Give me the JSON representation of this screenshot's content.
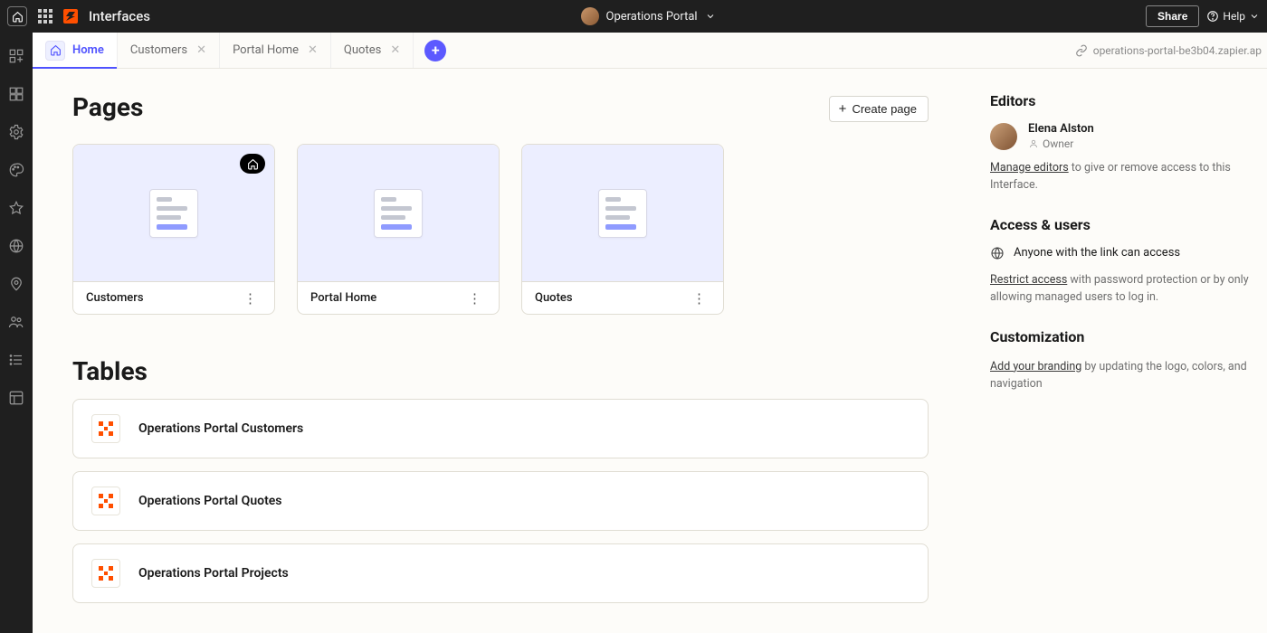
{
  "topbar": {
    "title": "Interfaces",
    "project_name": "Operations Portal",
    "share_label": "Share",
    "help_label": "Help"
  },
  "tabs": {
    "items": [
      {
        "label": "Home",
        "closable": false,
        "active": true
      },
      {
        "label": "Customers",
        "closable": true,
        "active": false
      },
      {
        "label": "Portal Home",
        "closable": true,
        "active": false
      },
      {
        "label": "Quotes",
        "closable": true,
        "active": false
      }
    ],
    "url_text": "operations-portal-be3b04.zapier.ap"
  },
  "pages": {
    "heading": "Pages",
    "create_label": "Create page",
    "cards": [
      {
        "name": "Customers",
        "is_home": true
      },
      {
        "name": "Portal Home",
        "is_home": false
      },
      {
        "name": "Quotes",
        "is_home": false
      }
    ]
  },
  "tables": {
    "heading": "Tables",
    "rows": [
      {
        "name": "Operations Portal Customers"
      },
      {
        "name": "Operations Portal Quotes"
      },
      {
        "name": "Operations Portal Projects"
      }
    ]
  },
  "side": {
    "editors_heading": "Editors",
    "editor_name": "Elena Alston",
    "editor_role": "Owner",
    "manage_editors_link": "Manage editors",
    "manage_editors_rest": " to give or remove access to this Interface.",
    "access_heading": "Access & users",
    "access_line": "Anyone with the link can access",
    "restrict_link": "Restrict access",
    "restrict_rest": " with password protection or by only allowing managed users to log in.",
    "custom_heading": "Customization",
    "branding_link": "Add your branding",
    "branding_rest": " by updating the logo, colors, and navigation"
  }
}
